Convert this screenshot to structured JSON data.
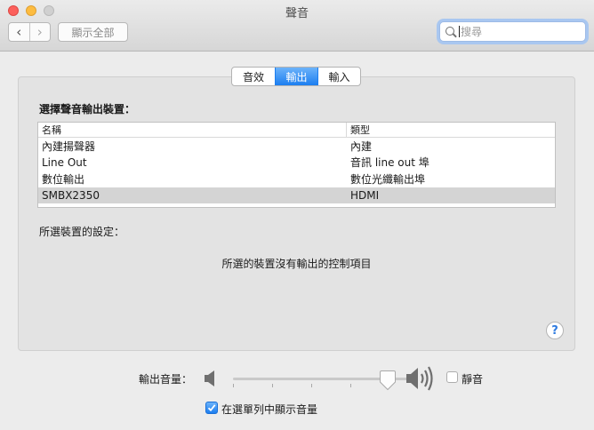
{
  "window": {
    "title": "聲音",
    "show_all_label": "顯示全部",
    "search_placeholder": "搜尋"
  },
  "tabs": [
    {
      "label": "音效",
      "selected": false
    },
    {
      "label": "輸出",
      "selected": true
    },
    {
      "label": "輸入",
      "selected": false
    }
  ],
  "output": {
    "section_label": "選擇聲音輸出裝置：",
    "columns": [
      "名稱",
      "類型"
    ],
    "devices": [
      {
        "name": "內建揚聲器",
        "type": "內建",
        "selected": false
      },
      {
        "name": "Line Out",
        "type": "音訊 line out 埠",
        "selected": false
      },
      {
        "name": "數位輸出",
        "type": "數位光纖輸出埠",
        "selected": false
      },
      {
        "name": "SMBX2350",
        "type": "HDMI",
        "selected": true
      }
    ],
    "settings_label": "所選裝置的設定：",
    "no_controls_text": "所選的裝置沒有輸出的控制項目"
  },
  "volume": {
    "label": "輸出音量：",
    "level": 0.9,
    "mute_label": "靜音",
    "mute_checked": false,
    "show_in_menubar_label": "在選單列中顯示音量",
    "show_in_menubar_checked": true
  },
  "help_label": "?",
  "colors": {
    "accent": "#1c7ef0",
    "selected_row": "#d4d4d4"
  }
}
